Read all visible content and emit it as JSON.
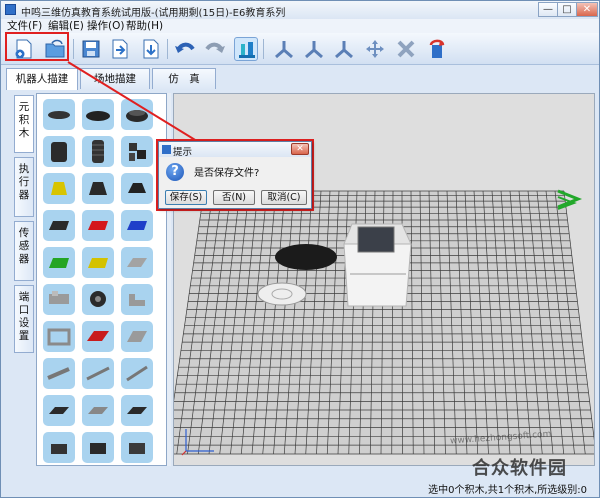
{
  "window": {
    "title": "中鸣三维仿真教育系统试用版-(试用期剩(15日)-E6教育系列",
    "min_glyph": "—",
    "max_glyph": "□",
    "close_glyph": "✕"
  },
  "menu": [
    {
      "label": "文件(F)"
    },
    {
      "label": "编辑(E)"
    },
    {
      "label": "操作(O)"
    },
    {
      "label": "帮助(H)"
    }
  ],
  "toolbar": {
    "icons": [
      "new-file-icon",
      "open-file-icon",
      "save-icon",
      "save-as-icon",
      "export-icon",
      "undo-icon",
      "redo-icon",
      "robot-build-icon",
      "rotate-x-icon",
      "rotate-y-icon",
      "rotate-z-icon",
      "move-icon",
      "delete-icon",
      "exit-icon"
    ]
  },
  "tabs": [
    {
      "label": "机器人描建",
      "active": true
    },
    {
      "label": "场地描建",
      "active": false
    },
    {
      "label": "仿　真",
      "active": false
    }
  ],
  "side_tabs": [
    {
      "label": "元积木",
      "active": true
    },
    {
      "label": "执行器",
      "active": false
    },
    {
      "label": "传感器",
      "active": false
    },
    {
      "label": "端口设置",
      "active": false
    }
  ],
  "dialog": {
    "title": "提示",
    "message": "是否保存文件?",
    "close_glyph": "✕",
    "question_glyph": "?",
    "buttons": [
      {
        "label": "保存(S)"
      },
      {
        "label": "否(N)"
      },
      {
        "label": "取消(C)"
      }
    ]
  },
  "status": {
    "text": "选中0个积木,共1个积木,所选级别:0"
  },
  "watermark": {
    "text": "合众软件园",
    "url": "www.hezhongsoft.com"
  },
  "colors": {
    "highlight": "#e02020",
    "palette_cell": "#a9d3ef",
    "viewport_bg": "#dedede"
  }
}
